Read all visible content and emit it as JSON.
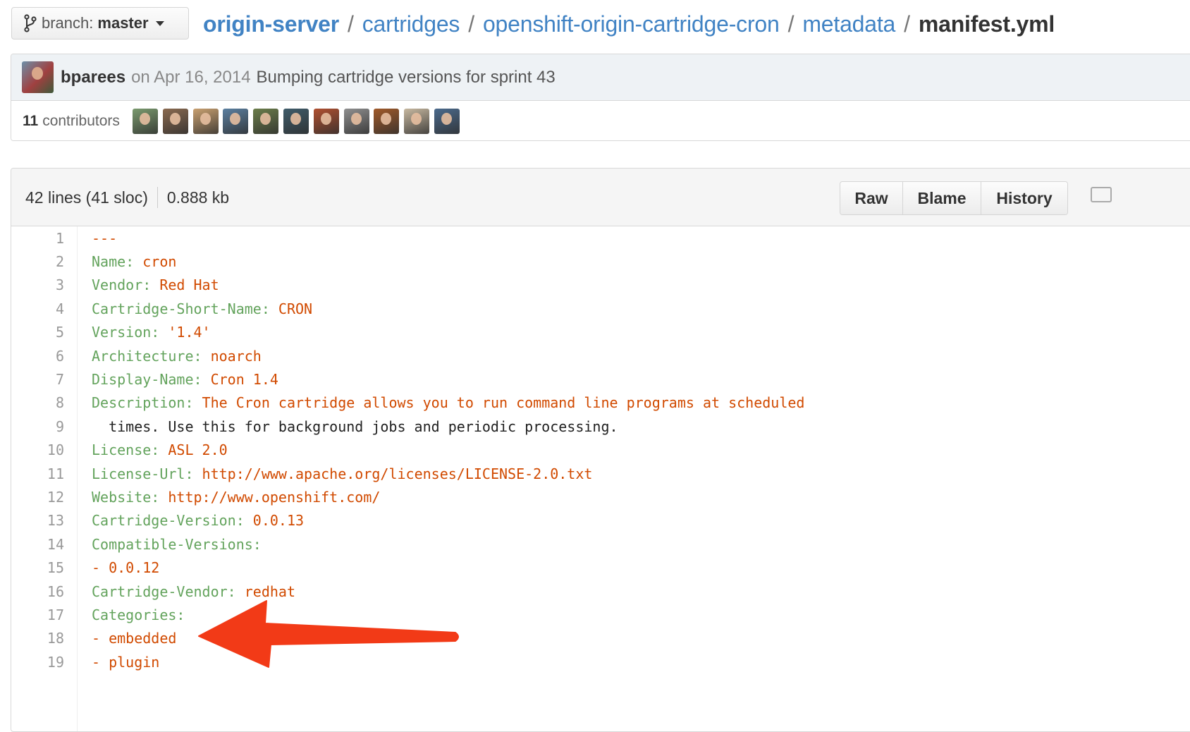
{
  "branch": {
    "prefix": "branch:",
    "name": "master"
  },
  "breadcrumb": {
    "items": [
      "origin-server",
      "cartridges",
      "openshift-origin-cartridge-cron",
      "metadata"
    ],
    "separator": "/",
    "current": "manifest.yml"
  },
  "commit": {
    "author": "bparees",
    "date": "on Apr 16, 2014",
    "message": "Bumping cartridge versions for sprint 43",
    "contributors_count": "11",
    "contributors_label": "contributors",
    "contributor_avatar_colors": [
      "#7a9a6e",
      "#8a6a50",
      "#c9a070",
      "#5b7fa0",
      "#6b7d4a",
      "#3f5c6a",
      "#b05030",
      "#8f8f8f",
      "#a05a2a",
      "#c7b8a0",
      "#4b6a8c"
    ]
  },
  "file": {
    "lines_info": "42 lines (41 sloc)",
    "size": "0.888 kb",
    "buttons": {
      "raw": "Raw",
      "blame": "Blame",
      "history": "History"
    }
  },
  "code_lines": [
    {
      "n": "1",
      "key": "",
      "value": "---",
      "plain": ""
    },
    {
      "n": "2",
      "key": "Name:",
      "value": "cron",
      "plain": ""
    },
    {
      "n": "3",
      "key": "Vendor:",
      "value": "Red Hat",
      "plain": ""
    },
    {
      "n": "4",
      "key": "Cartridge-Short-Name:",
      "value": "CRON",
      "plain": ""
    },
    {
      "n": "5",
      "key": "Version:",
      "value": "'1.4'",
      "plain": ""
    },
    {
      "n": "6",
      "key": "Architecture:",
      "value": "noarch",
      "plain": ""
    },
    {
      "n": "7",
      "key": "Display-Name:",
      "value": "Cron 1.4",
      "plain": ""
    },
    {
      "n": "8",
      "key": "Description:",
      "value": "The Cron cartridge allows you to run command line programs at scheduled",
      "plain": ""
    },
    {
      "n": "9",
      "key": "",
      "value": "",
      "plain": "  times. Use this for background jobs and periodic processing."
    },
    {
      "n": "10",
      "key": "License:",
      "value": "ASL 2.0",
      "plain": ""
    },
    {
      "n": "11",
      "key": "License-Url:",
      "value": "http://www.apache.org/licenses/LICENSE-2.0.txt",
      "plain": ""
    },
    {
      "n": "12",
      "key": "Website:",
      "value": "http://www.openshift.com/",
      "plain": ""
    },
    {
      "n": "13",
      "key": "Cartridge-Version:",
      "value": "0.0.13",
      "plain": ""
    },
    {
      "n": "14",
      "key": "Compatible-Versions:",
      "value": "",
      "plain": ""
    },
    {
      "n": "15",
      "key": "",
      "value": "- 0.0.12",
      "plain": ""
    },
    {
      "n": "16",
      "key": "Cartridge-Vendor:",
      "value": "redhat",
      "plain": ""
    },
    {
      "n": "17",
      "key": "Categories:",
      "value": "",
      "plain": ""
    },
    {
      "n": "18",
      "key": "",
      "value": "- embedded",
      "plain": ""
    },
    {
      "n": "19",
      "key": "",
      "value": "- plugin",
      "plain": ""
    }
  ],
  "colors": {
    "link": "#4183c4",
    "yaml_key": "#63a35c",
    "yaml_value": "#d14a00",
    "annotation_arrow": "#f23a17"
  },
  "icons": [
    "git-branch-icon",
    "caret-down-icon",
    "desktop-icon",
    "red-annotation-arrow"
  ]
}
